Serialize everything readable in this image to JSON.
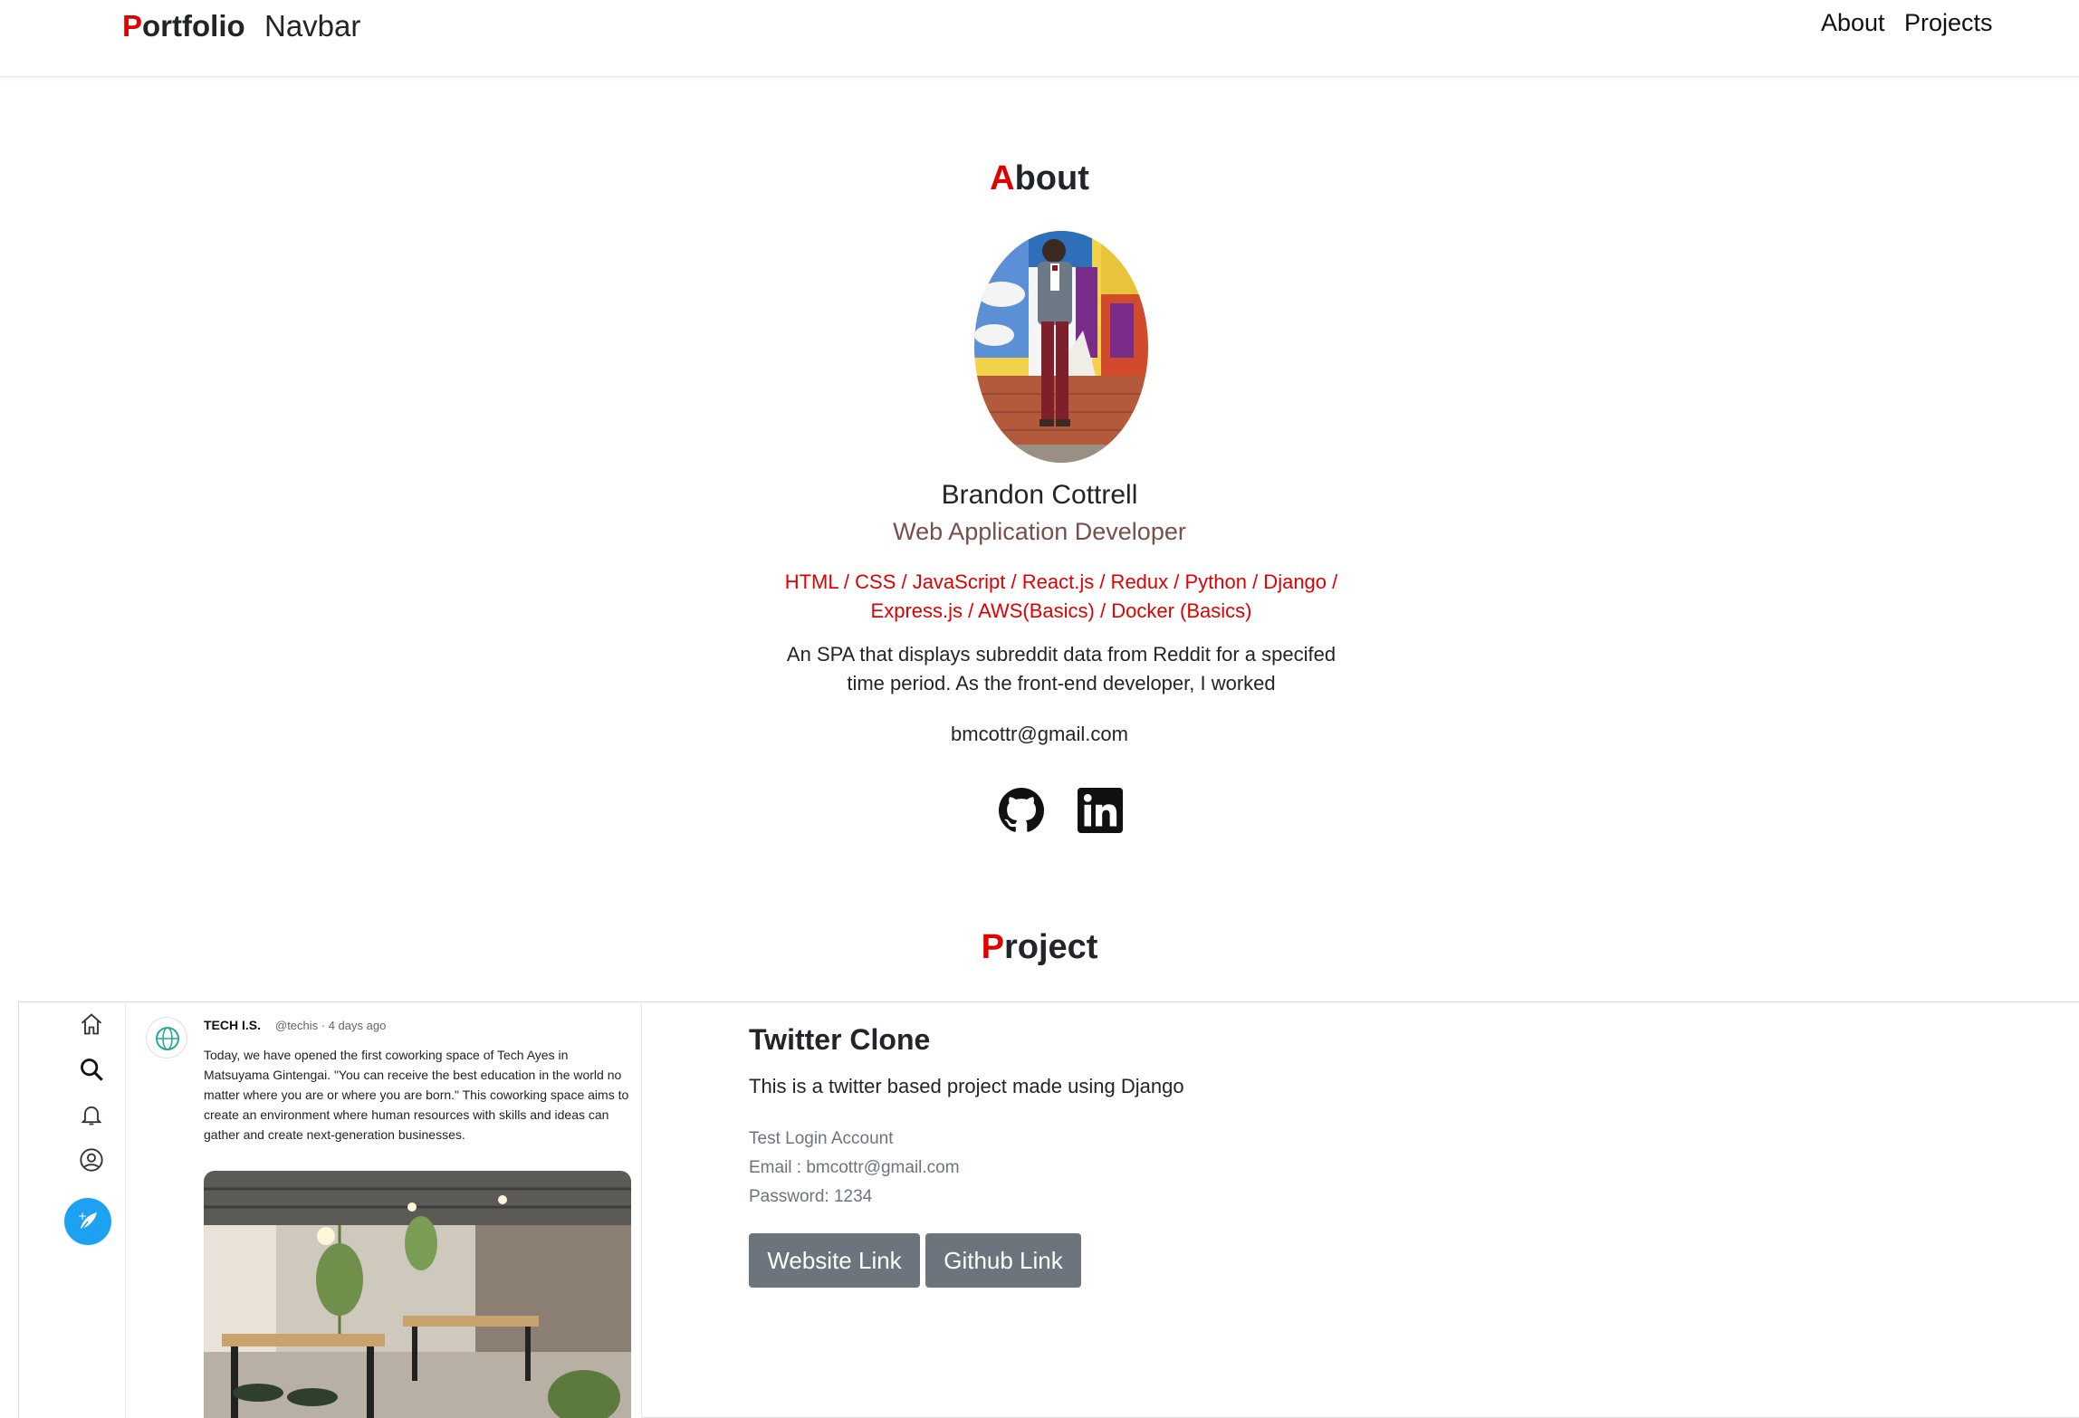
{
  "navbar": {
    "brand_first": "P",
    "brand_rest": "ortfolio",
    "brand_sub": "Navbar",
    "links": [
      "About",
      "Projects"
    ]
  },
  "about": {
    "title_first": "A",
    "title_rest": "bout",
    "name": "Brandon Cottrell",
    "role": "Web Application Developer",
    "skills": "HTML / CSS / JavaScript / React.js / Redux / Python / Django / Express.js / AWS(Basics) / Docker (Basics)",
    "description": "An SPA that displays subreddit data from Reddit for a specifed time period. As the front-end developer, I worked",
    "email": "bmcottr@gmail.com",
    "social_icons": [
      "github-icon",
      "linkedin-icon"
    ]
  },
  "project_section": {
    "title_first": "P",
    "title_rest": "roject"
  },
  "project": {
    "screenshot": {
      "account_name": "TECH I.S.",
      "account_meta": "@techis · 4 days ago",
      "tweet_text": "Today, we have opened the first coworking space of Tech Ayes in Matsuyama Gintengai. \"You can receive the best education in the world no matter where you are or where you are born.\" This coworking space aims to create an environment where human resources with skills and ideas can gather and create next-generation businesses.",
      "side_icons": [
        "home-icon",
        "search-icon",
        "bell-icon",
        "profile-icon",
        "compose-icon"
      ]
    },
    "title": "Twitter Clone",
    "description": "This is a twitter based project made using Django",
    "login_heading": "Test Login Account",
    "login_email": "Email : bmcottr@gmail.com",
    "login_password": "Password: 1234",
    "website_button": "Website Link",
    "github_button": "Github Link"
  },
  "colors": {
    "accent": "#e00000",
    "role": "#7a4f4b",
    "button": "#6c757d",
    "twitter_blue": "#1da1f2"
  }
}
